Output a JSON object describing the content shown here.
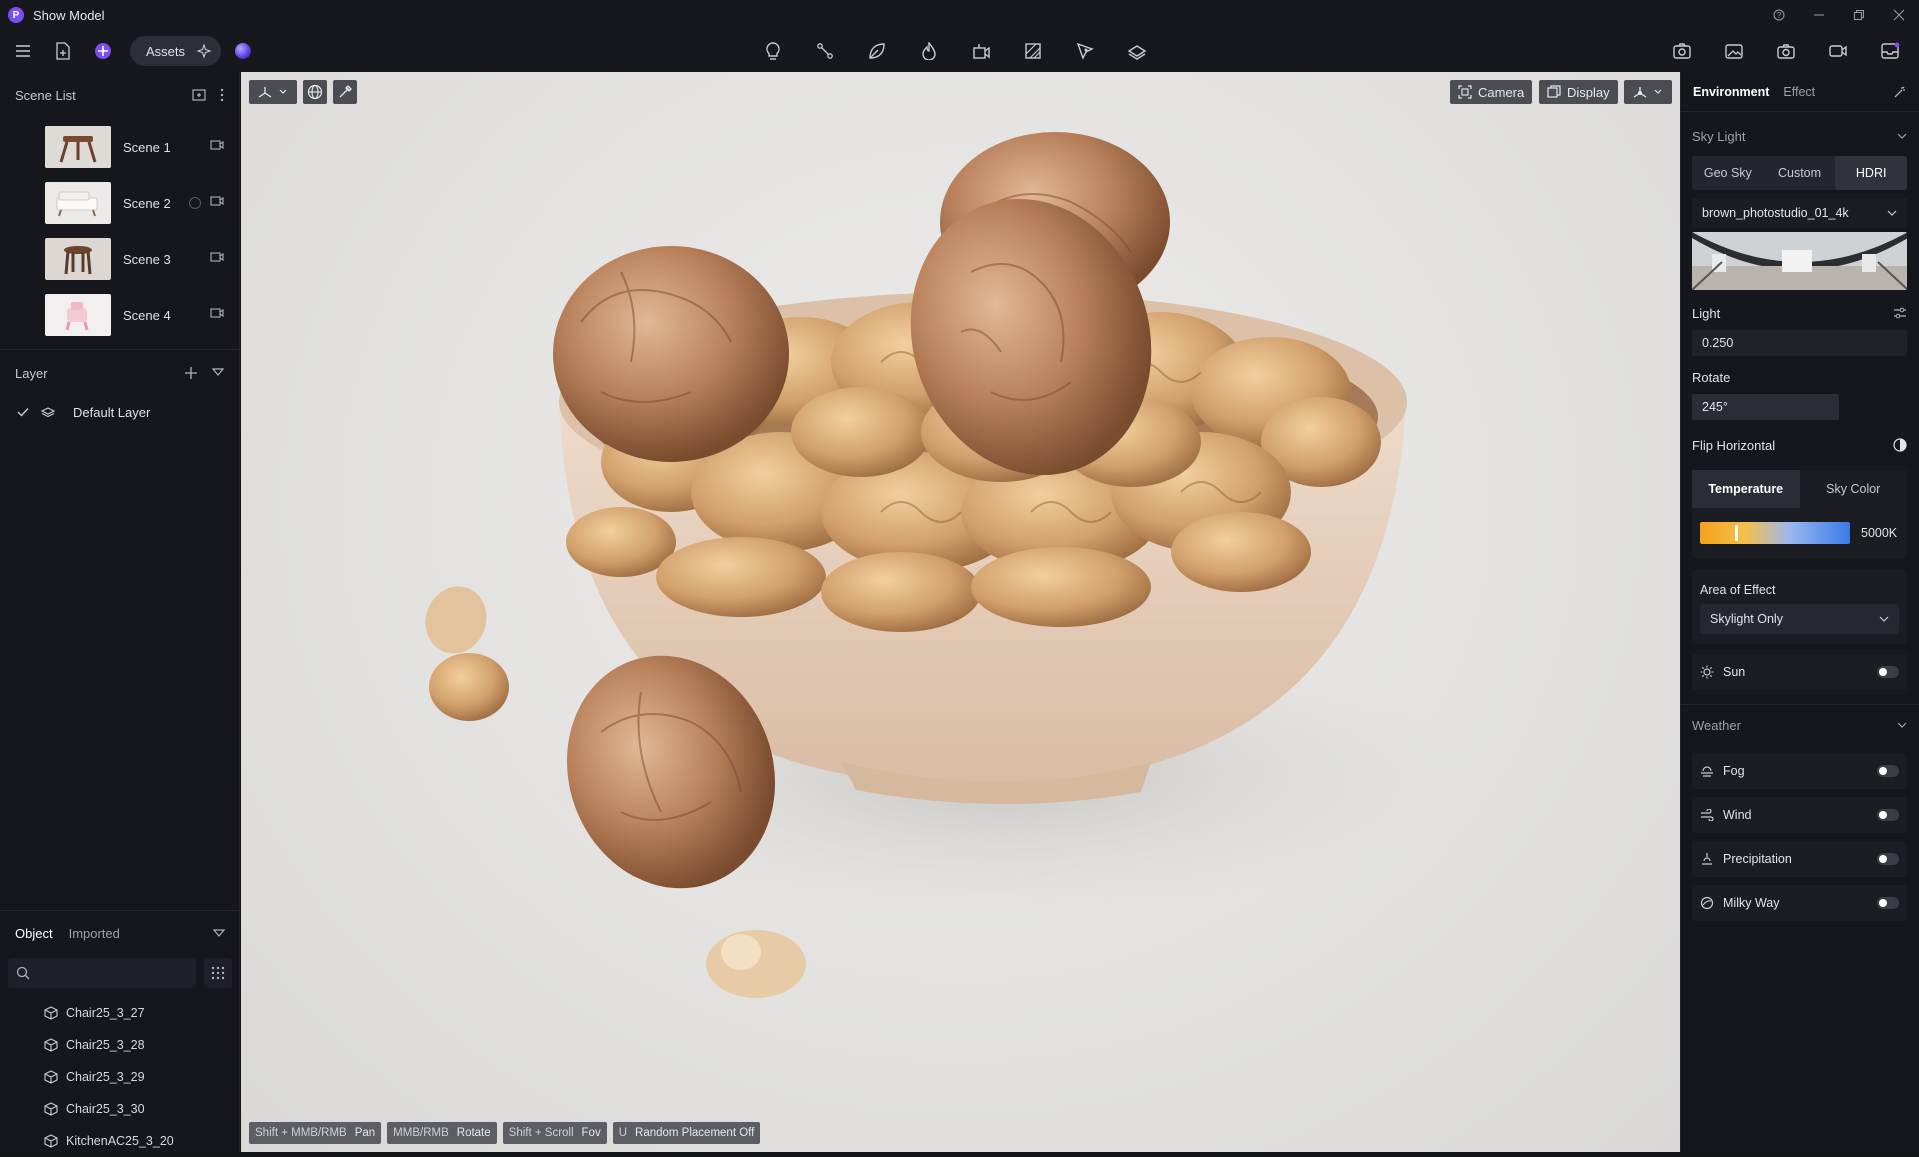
{
  "app": {
    "title": "Show Model",
    "logo_letter": "P"
  },
  "toolbar": {
    "assets_label": "Assets"
  },
  "scene_list": {
    "title": "Scene List",
    "scenes": [
      {
        "label": "Scene 1"
      },
      {
        "label": "Scene 2"
      },
      {
        "label": "Scene 3"
      },
      {
        "label": "Scene 4"
      }
    ]
  },
  "layer": {
    "title": "Layer",
    "items": [
      {
        "label": "Default Layer"
      }
    ]
  },
  "objects": {
    "tabs": [
      "Object",
      "Imported"
    ],
    "items": [
      "Chair25_3_27",
      "Chair25_3_28",
      "Chair25_3_29",
      "Chair25_3_30",
      "KitchenAC25_3_20"
    ]
  },
  "viewport": {
    "camera_label": "Camera",
    "display_label": "Display",
    "hints": [
      {
        "key": "Shift + MMB/RMB",
        "action": "Pan"
      },
      {
        "key": "MMB/RMB",
        "action": "Rotate"
      },
      {
        "key": "Shift + Scroll",
        "action": "Fov"
      },
      {
        "key": "U",
        "action": "Random Placement Off"
      }
    ]
  },
  "right_panel": {
    "tabs": [
      "Environment",
      "Effect"
    ],
    "sky_light": {
      "title": "Sky Light",
      "modes": [
        "Geo Sky",
        "Custom",
        "HDRI"
      ],
      "active_mode": "HDRI",
      "hdri_name": "brown_photostudio_01_4k",
      "light_label": "Light",
      "light_value": "0.250",
      "rotate_label": "Rotate",
      "rotate_value": "245°",
      "flip_label": "Flip Horizontal",
      "temp_tabs": [
        "Temperature",
        "Sky Color"
      ],
      "temperature_value": "5000K",
      "temperature_fraction": 0.24,
      "area_label": "Area of Effect",
      "area_value": "Skylight Only",
      "sun_label": "Sun"
    },
    "weather": {
      "title": "Weather",
      "items": [
        "Fog",
        "Wind",
        "Precipitation",
        "Milky Way"
      ]
    }
  },
  "colors": {
    "accent": "#7b4df2",
    "panel": "#15171c"
  }
}
